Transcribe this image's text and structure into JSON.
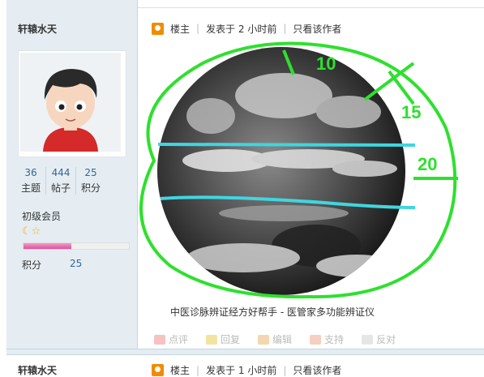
{
  "author": {
    "name": "轩辕水天",
    "stats": [
      {
        "value": "36",
        "label": "主题"
      },
      {
        "value": "444",
        "label": "帖子"
      },
      {
        "value": "25",
        "label": "积分"
      }
    ],
    "level": "初级会员",
    "points_label": "积分",
    "points_value": "25",
    "progress": 0.45
  },
  "post": {
    "owner_label": "楼主",
    "posted": "发表于 2 小时前",
    "only_author": "只看该作者",
    "annotations": {
      "top": "10",
      "right_upper": "15",
      "right_mid": "20"
    },
    "caption": "中医诊脉辨证经方好帮手 - 医管家多功能辨证仪"
  },
  "actions": [
    {
      "label": "点评"
    },
    {
      "label": "回复"
    },
    {
      "label": "编辑"
    },
    {
      "label": "支持"
    },
    {
      "label": "反对"
    }
  ],
  "next_post": {
    "author": "轩辕水天",
    "owner_label": "楼主",
    "posted": "发表于 1 小时前",
    "only_author": "只看该作者"
  },
  "colors": {
    "accent_blue": "#336699",
    "annotation_green": "#2ee02e",
    "annotation_cyan": "#3fd6e0"
  }
}
